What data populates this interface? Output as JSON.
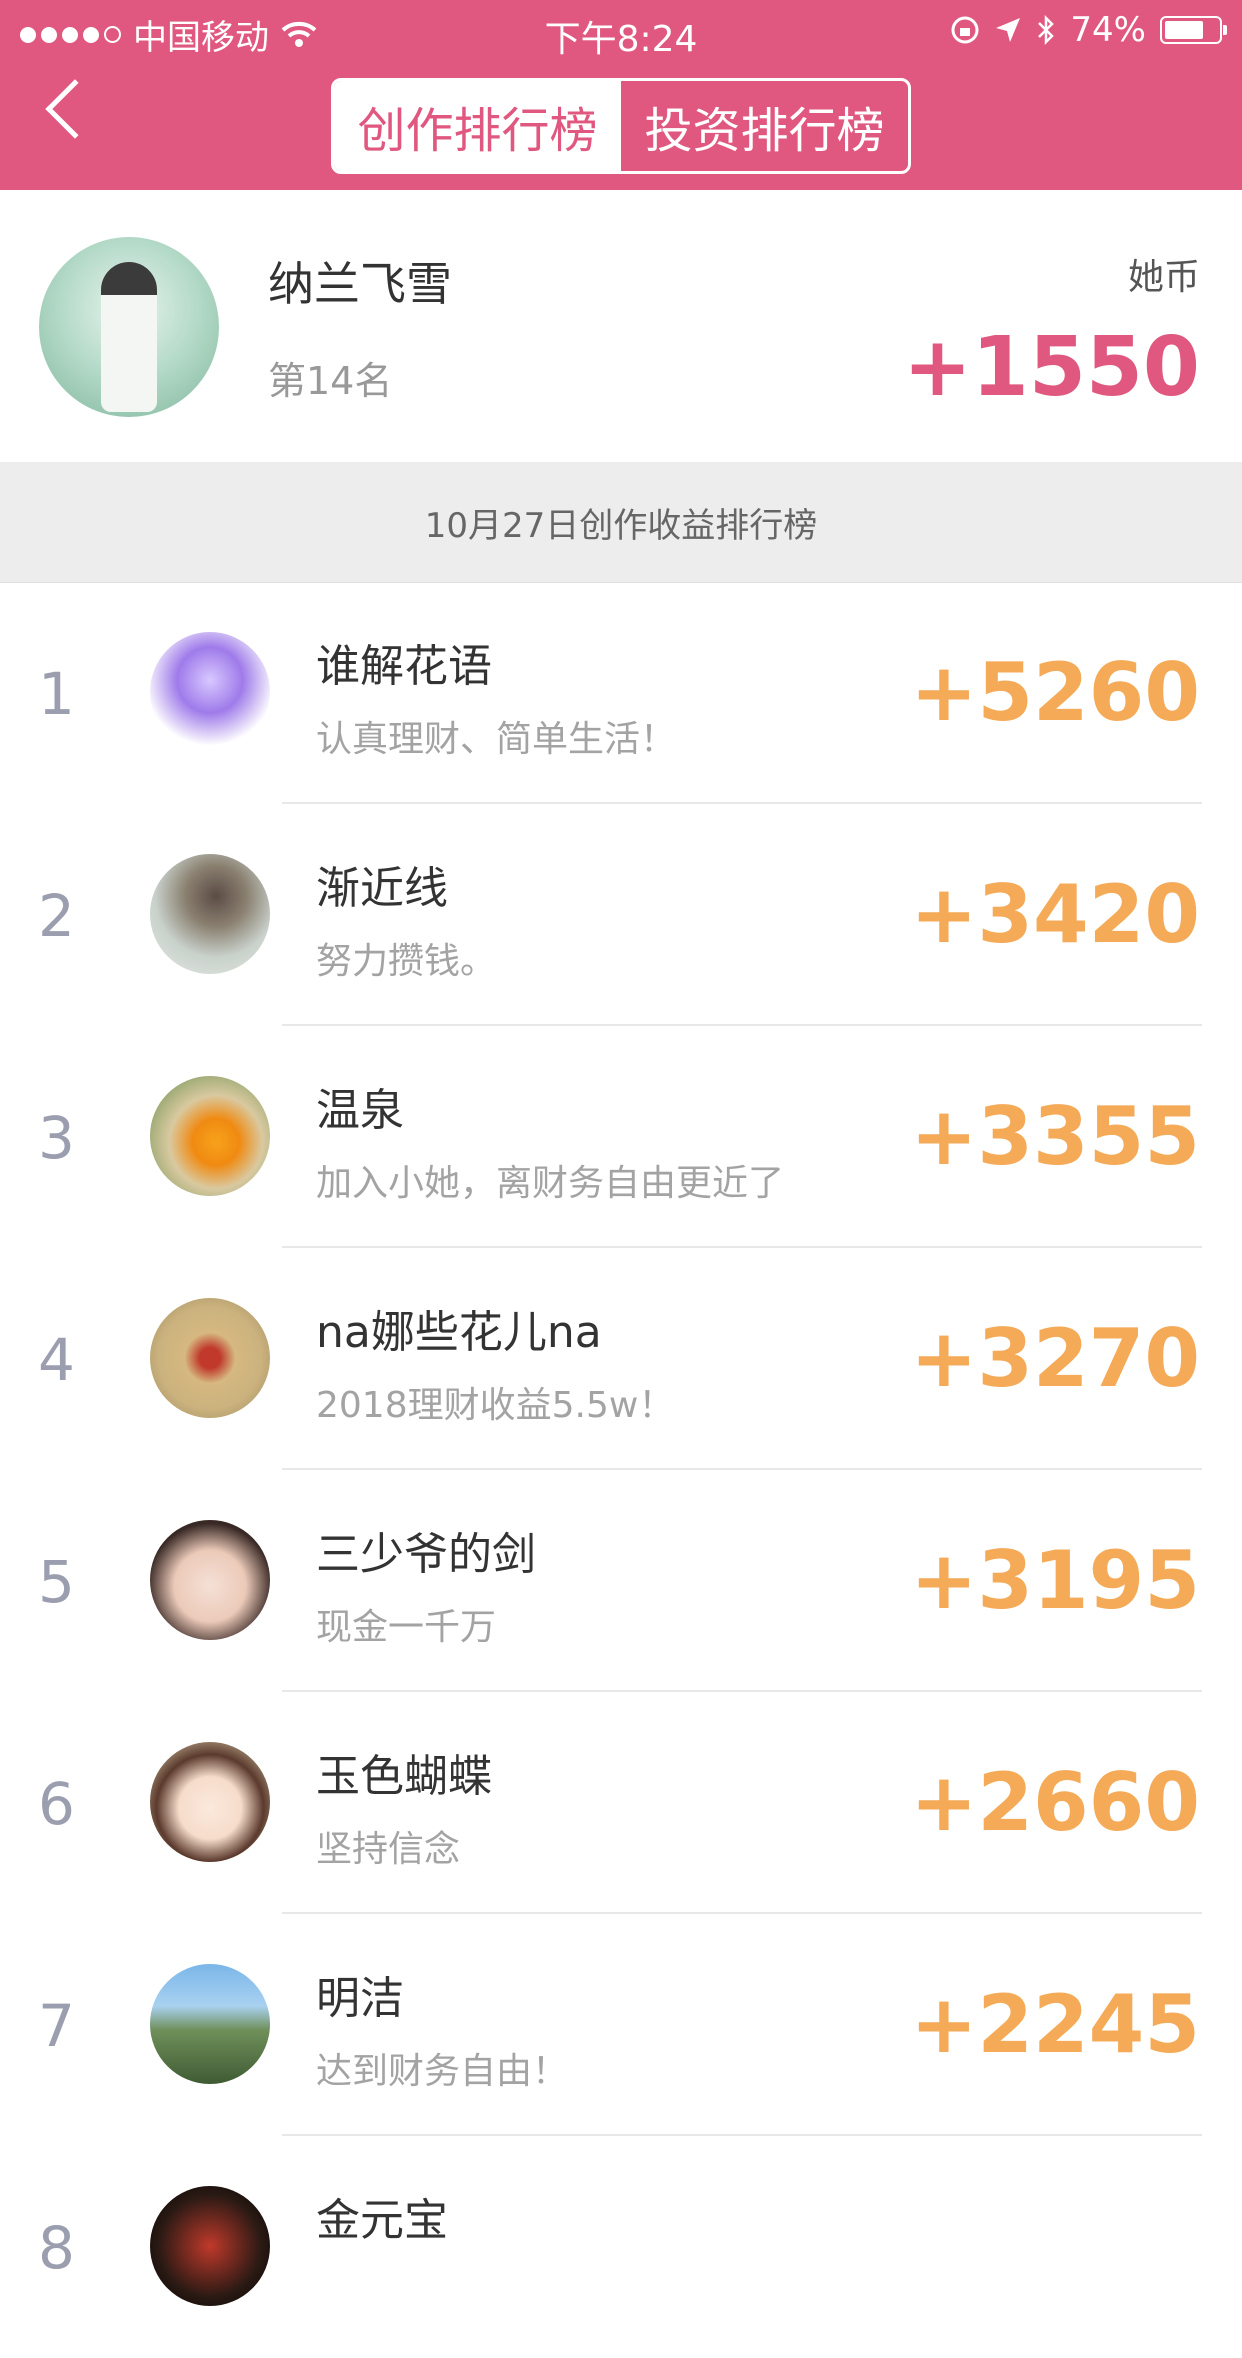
{
  "status_bar": {
    "carrier": "中国移动",
    "time": "下午8:24",
    "battery": "74%",
    "battery_level": 0.74
  },
  "header": {
    "tabs": [
      {
        "label": "创作排行榜",
        "active": true
      },
      {
        "label": "投资排行榜",
        "active": false
      }
    ],
    "accent_color": "#e0587f"
  },
  "me": {
    "name": "纳兰飞雪",
    "rank": "第14名",
    "unit": "她币",
    "score": "+1550"
  },
  "banner": {
    "text": "10月27日创作收益排行榜"
  },
  "ranking": [
    {
      "rank": "1",
      "name": "谁解花语",
      "motto": "认真理财、简单生活！",
      "score": "+5260"
    },
    {
      "rank": "2",
      "name": "渐近线",
      "motto": "努力攒钱。",
      "score": "+3420"
    },
    {
      "rank": "3",
      "name": "温泉",
      "motto": "加入小她，离财务自由更近了",
      "score": "+3355"
    },
    {
      "rank": "4",
      "name": "na娜些花儿na",
      "motto": "2018理财收益5.5w！",
      "score": "+3270"
    },
    {
      "rank": "5",
      "name": "三少爷的剑",
      "motto": "现金一千万",
      "score": "+3195"
    },
    {
      "rank": "6",
      "name": "玉色蝴蝶",
      "motto": "坚持信念",
      "score": "+2660"
    },
    {
      "rank": "7",
      "name": "明洁",
      "motto": "达到财务自由！",
      "score": "+2245"
    },
    {
      "rank": "8",
      "name": "金元宝",
      "motto": "",
      "score": ""
    }
  ],
  "score_color": "#f4aa57"
}
